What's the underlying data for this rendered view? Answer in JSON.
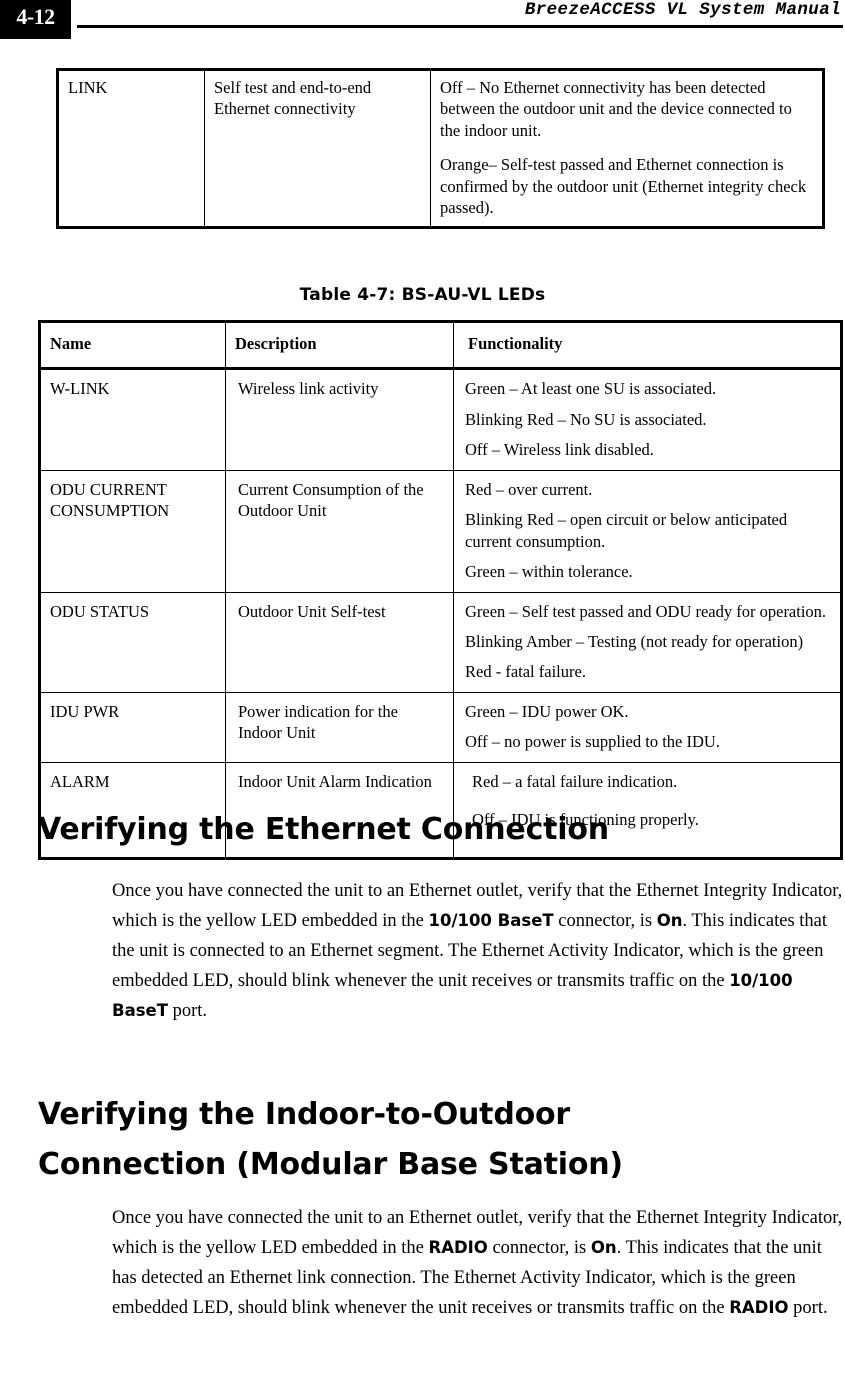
{
  "header": {
    "page_number": "4-12",
    "manual_title": "BreezeACCESS VL System Manual"
  },
  "table_link_continued": {
    "rows": [
      {
        "name": "LINK",
        "description": "Self test and end-to-end Ethernet connectivity",
        "functionality": [
          "Off – No Ethernet connectivity has been detected between the outdoor unit and the device connected to the indoor unit.",
          "Orange– Self-test passed and Ethernet connection is confirmed by the outdoor unit (Ethernet integrity check passed)."
        ]
      }
    ]
  },
  "table_caption": "Table 4-7: BS-AU-VL LEDs",
  "table_bs_au_vl": {
    "columns": [
      "Name",
      "Description",
      "Functionality"
    ],
    "rows": [
      {
        "name": "W-LINK",
        "name_line2": "",
        "description": "Wireless link activity",
        "functionality": [
          "Green – At least one SU is associated.",
          "Blinking Red – No SU is associated.",
          "Off – Wireless link disabled."
        ]
      },
      {
        "name": "ODU CURRENT",
        "name_line2": "CONSUMPTION",
        "description": "Current Consumption of the Outdoor Unit",
        "functionality": [
          "Red – over current.",
          "Blinking Red – open circuit or below anticipated current consumption.",
          "Green – within tolerance."
        ]
      },
      {
        "name": "ODU STATUS",
        "name_line2": "",
        "description": "Outdoor Unit Self-test",
        "functionality": [
          "Green – Self test passed and ODU ready for operation.",
          "Blinking Amber  – Testing  (not ready for operation)",
          "Red - fatal failure."
        ]
      },
      {
        "name": "IDU PWR",
        "name_line2": "",
        "description": "Power indication for the Indoor Unit",
        "functionality": [
          "Green – IDU power OK.",
          "Off – no power is supplied to the IDU."
        ]
      },
      {
        "name": "ALARM",
        "name_line2": "",
        "description": "Indoor Unit Alarm Indication",
        "functionality": [
          "Red – a fatal failure indication.",
          "Off – IDU is functioning properly."
        ]
      }
    ]
  },
  "sections": [
    {
      "heading": "Verifying the Ethernet Connection",
      "paragraph_parts": [
        {
          "text": "Once you have connected the unit to an Ethernet outlet, verify that the Ethernet Integrity Indicator, which is the yellow LED embedded in the ",
          "bold": false
        },
        {
          "text": "10/100 BaseT",
          "bold": true
        },
        {
          "text": " connector, is ",
          "bold": false
        },
        {
          "text": "On",
          "bold": true
        },
        {
          "text": ". This indicates that the unit is connected to an Ethernet segment. The Ethernet Activity Indicator, which is the green embedded LED, should blink whenever the unit receives or transmits traffic on the ",
          "bold": false
        },
        {
          "text": "10/100 BaseT",
          "bold": true
        },
        {
          "text": " port.",
          "bold": false
        }
      ]
    },
    {
      "heading": "Verifying the Indoor-to-Outdoor Connection (Modular Base Station)",
      "paragraph_parts": [
        {
          "text": "Once you have connected the unit to an Ethernet outlet, verify that the Ethernet Integrity Indicator, which is the yellow LED embedded in the ",
          "bold": false
        },
        {
          "text": "RADIO",
          "bold": true
        },
        {
          "text": " connector, is ",
          "bold": false
        },
        {
          "text": "On",
          "bold": true
        },
        {
          "text": ". This indicates that the unit has detected an Ethernet link connection. The Ethernet Activity Indicator, which is the green embedded LED, should blink whenever the unit receives or transmits traffic on the ",
          "bold": false
        },
        {
          "text": "RADIO",
          "bold": true
        },
        {
          "text": " port.",
          "bold": false
        }
      ]
    }
  ]
}
